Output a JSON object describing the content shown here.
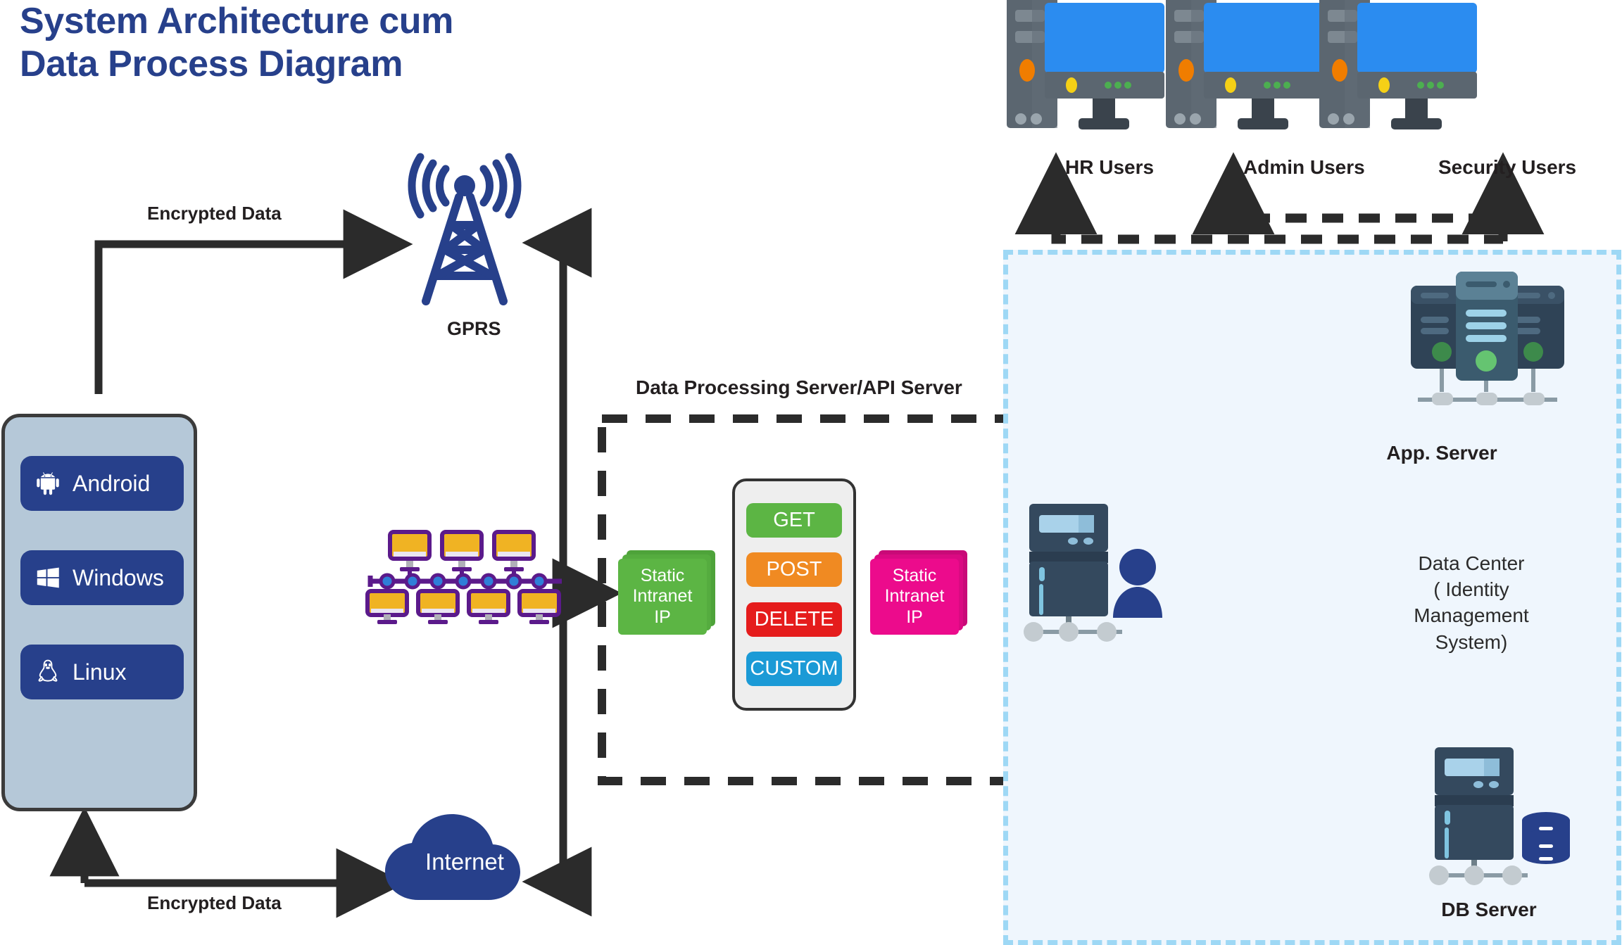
{
  "title": {
    "line1": "System Architecture cum",
    "line2": "Data Process Diagram",
    "color": "#27408b"
  },
  "devices": {
    "panel_name": "client-devices",
    "items": [
      {
        "label": "Android",
        "icon": "android-icon"
      },
      {
        "label": "Windows",
        "icon": "windows-icon"
      },
      {
        "label": "Linux",
        "icon": "linux-penguin-icon"
      }
    ],
    "panel_bg": "#b5c8d8",
    "button_bg": "#27408b"
  },
  "flows": {
    "encrypted_top": "Encrypted Data",
    "encrypted_bottom": "Encrypted Data"
  },
  "gprs": {
    "label": "GPRS",
    "icon": "radio-tower-icon",
    "color": "#27408b"
  },
  "internet": {
    "label": "Internet",
    "icon": "cloud-icon",
    "color": "#27408b"
  },
  "network_cluster": {
    "name": "intranet-workstations",
    "top_count": 3,
    "bottom_count": 4,
    "outline_color": "#5b1a8b",
    "screen_color": "#f0b323",
    "node_color": "#2f7ed8"
  },
  "api_server": {
    "title": "Data Processing Server/API Server",
    "ip_in": {
      "label_line1": "Static",
      "label_line2": "Intranet",
      "label_line3": "IP",
      "color": "#5cb544"
    },
    "ip_out": {
      "label_line1": "Static",
      "label_line2": "Intranet",
      "label_line3": "IP",
      "color": "#ec0b8c"
    },
    "methods": [
      {
        "label": "GET",
        "color": "#5cb544"
      },
      {
        "label": "POST",
        "color": "#f08a22"
      },
      {
        "label": "DELETE",
        "color": "#e51c1c"
      },
      {
        "label": "CUSTOM",
        "color": "#1b9ad6"
      }
    ]
  },
  "data_center": {
    "label_line1": "Data Center",
    "label_line2": "( Identity",
    "label_line3": "Management",
    "label_line4": "System)",
    "border_color": "#9ed8f5",
    "fill_color": "#eff6fd",
    "app_server_label": "App. Server",
    "db_server_label": "DB Server",
    "identity_server_icon": "server-with-user-icon",
    "link_color": "#3b2c8f"
  },
  "users": [
    {
      "label": "HR Users",
      "icon": "desktop-computer-icon"
    },
    {
      "label": "Admin Users",
      "icon": "desktop-computer-icon"
    },
    {
      "label": "Security Users",
      "icon": "desktop-computer-icon"
    }
  ]
}
